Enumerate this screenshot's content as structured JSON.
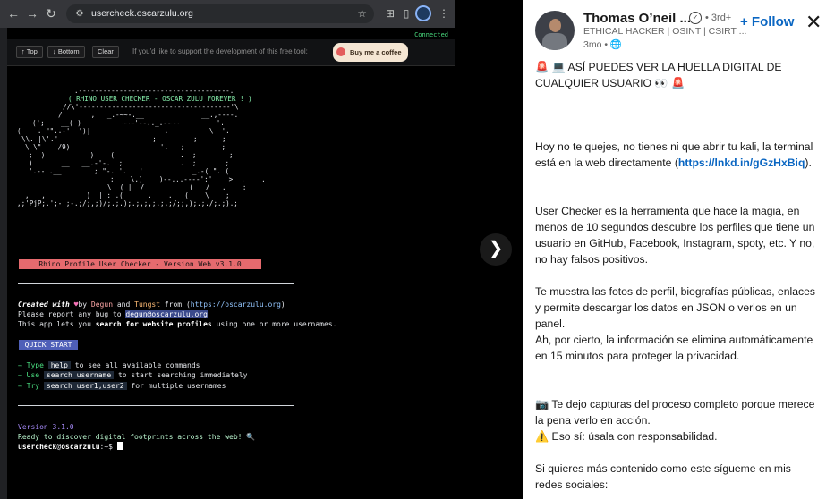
{
  "browser": {
    "url": "usercheck.oscarzulu.org",
    "connected": "Connected",
    "buttons": {
      "top": "↑ Top",
      "bottom": "↓ Bottom",
      "clear": "Clear"
    },
    "support_text": "If you'd like to support the development of this free tool:",
    "coffee_label": "Buy me a coffee"
  },
  "terminal": {
    "ascii": [
      ".-------------------------------------.",
      "( RHINO USER CHECKER - OSCAR ZULU FOREVER ! )",
      "//\\'-------------------------------------'\\",
      "/       ,   _.-~~-.__              __.,----.",
      "(';    __( )          ~~~'--.._.--~~         '.",
      "(    . \"\"..-'  ')|                  .          \\  '.",
      "\\\\. |\\'.'                       ;      .  ;      ;",
      "\\ \\\"    /9)                      '.   ;         ;",
      ";  )           )    (                .  ;        ;",
      ")       __   __.-'-.  ;              .  ;       ;",
      "'.--..__        ; \"-. '.   '            _.-( \". (",
      ";    \\,)    )--,..----';'    >  ;    .",
      "\\  ( |  /           (   /   .    ;",
      ",   ,          )  | : .(      .    .   (    \\    ;",
      ",;'PjP;.';-.;-.;/;,;)/;.;.);.;,;,;.;,;/;;,);.;./;.;).;"
    ],
    "version_title": "Rhino Profile User Checker - Version Web v3.1.0",
    "created_with": "Created with",
    "by": "by",
    "degun": "Degun",
    "and": "and",
    "tungst": "Tungst",
    "from": "from (",
    "site": "https://oscarzulu.org",
    "close_paren": ")",
    "report_bug": "Please report any bug to ",
    "email": "degun@oscarzulu.org",
    "app_prefix": "This app lets you ",
    "app_bold": "search for website profiles",
    "app_suffix": " using one or more usernames.",
    "quick_start": "QUICK START",
    "qs1_a": "→ Type ",
    "qs1_code": "help",
    "qs1_b": " to see all available commands",
    "qs2_a": "→ Use ",
    "qs2_code": "search username",
    "qs2_b": " to start searching immediately",
    "qs3_a": "→ Try ",
    "qs3_code": "search user1,user2",
    "qs3_b": " for multiple usernames",
    "version": "Version 3.1.0",
    "ready": "Ready to discover digital footprints across the web! 🔍",
    "prompt_user": "usercheck",
    "prompt_at": "@",
    "prompt_host": "oscarzulu",
    "prompt_suffix": ":~$ "
  },
  "post": {
    "author": "Thomas O’neil ...",
    "degree": "• 3rd+",
    "follow_label": "+ Follow",
    "headline": "ETHICAL HACKER | OSINT | CSIRT ...",
    "meta": "3mo • 🌐",
    "title": "🚨 💻 ASÍ PUEDES VER LA HUELLA DIGITAL DE CUALQUIER USUARIO 👀 🚨",
    "p1": "Hoy no te quejes, no tienes ni que abrir tu kali, la terminal está en la web directamente",
    "p1_link": "https://lnkd.in/gGzHxBiq",
    "p2": "User Checker es la herramienta que hace la magia, en menos de 10 segundos descubre los perfiles que tiene un usuario en GitHub, Facebook, Instagram, spoty, etc. Y no, no hay falsos positivos.",
    "p3": "Te muestra las fotos de perfil, biografías públicas, enlaces y permite descargar los datos en JSON o verlos en un panel.",
    "p4": "Ah, por cierto, la información se elimina automáticamente en 15 minutos para proteger la privacidad.",
    "p5": "📷 Te dejo capturas del proceso completo porque merece la pena verlo en acción.",
    "p6": "⚠️ Eso sí: úsala con responsabilidad.",
    "p7": "Si quieres más contenido como este sígueme en mis redes sociales:"
  }
}
